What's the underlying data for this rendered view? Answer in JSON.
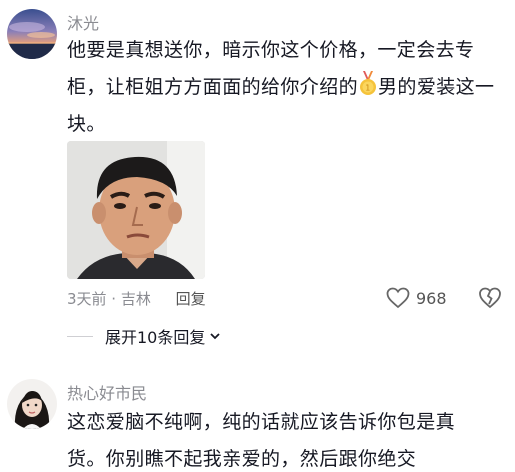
{
  "comments": [
    {
      "username": "沐光",
      "text_part1": "他要是真想送你，暗示你这个价格，一定会去专柜，让柜姐方方面面的给你介绍的",
      "text_part2": "男的爱装这一块。",
      "medal_icon": "gold-medal-icon",
      "sticker_icon": "man-face-sticker",
      "time_location": "3天前 · 吉林",
      "reply_label": "回复",
      "like_count": "968"
    },
    {
      "username": "热心好市民",
      "text": "这恋爱脑不纯啊，纯的话就应该告诉你包是真货。你别瞧不起我亲爱的，然后跟你绝交"
    }
  ],
  "expand_replies_label": "展开10条回复",
  "colors": {
    "meta_gray": "#8a8b91",
    "text_dark": "#161823"
  }
}
